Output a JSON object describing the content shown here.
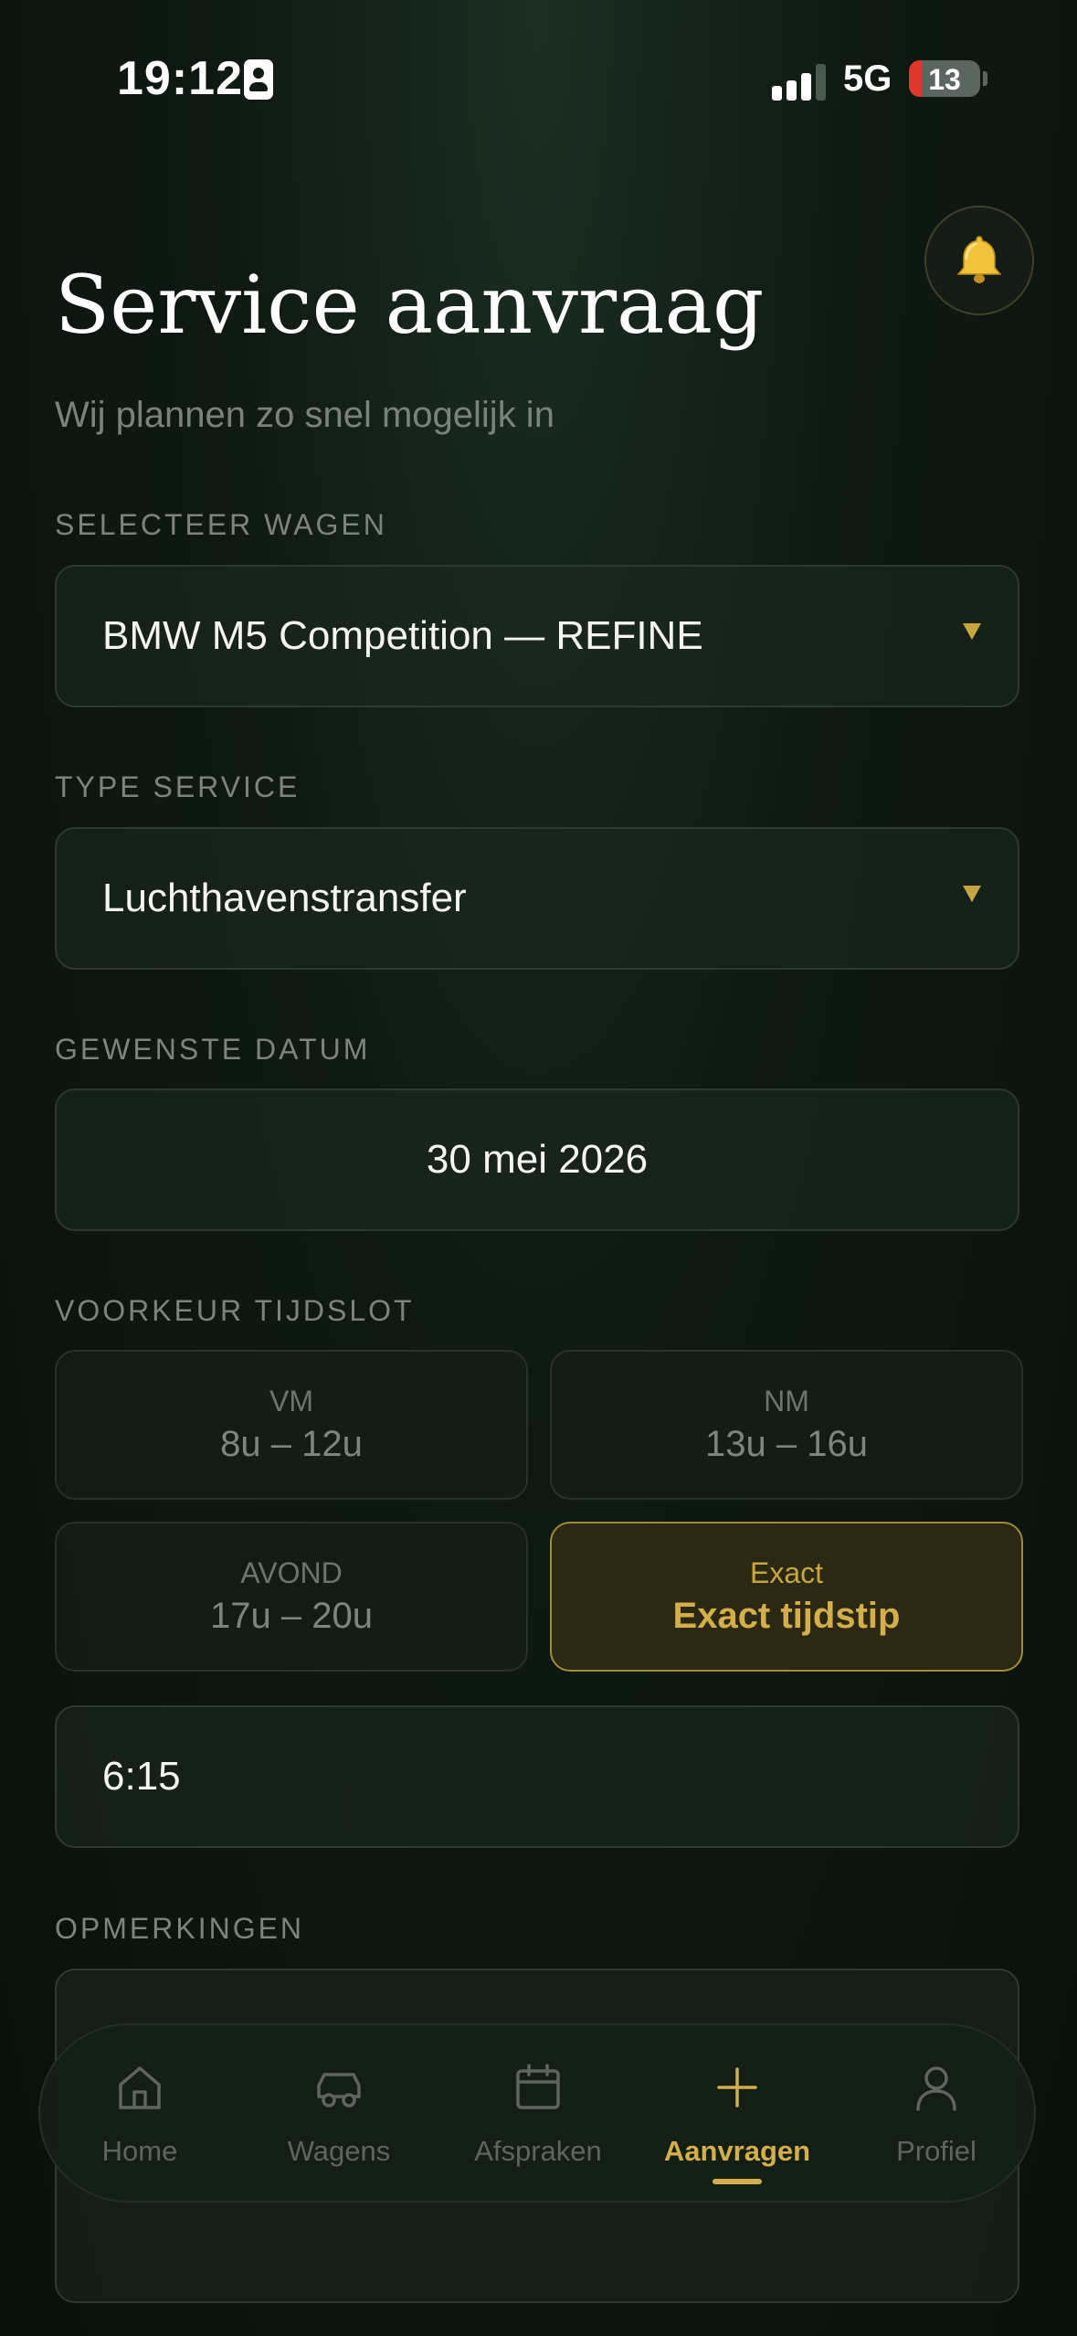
{
  "status_bar": {
    "time": "19:12",
    "network": "5G",
    "battery": "13"
  },
  "header": {
    "title": "Service aanvraag",
    "subtitle": "Wij plannen zo snel mogelijk in"
  },
  "form": {
    "vehicle": {
      "label": "SELECTEER WAGEN",
      "value": "BMW M5 Competition — REFINE"
    },
    "service": {
      "label": "TYPE SERVICE",
      "value": "Luchthavenstransfer"
    },
    "date": {
      "label": "GEWENSTE DATUM",
      "value": "30 mei 2026"
    },
    "timeslot": {
      "label": "VOORKEUR TIJDSLOT",
      "options": [
        {
          "key": "VM",
          "value": "8u – 12u"
        },
        {
          "key": "NM",
          "value": "13u – 16u"
        },
        {
          "key": "AVOND",
          "value": "17u – 20u"
        },
        {
          "key": "Exact",
          "value": "Exact tijdstip"
        }
      ],
      "selected": "Exact"
    },
    "exact_time": {
      "value": "6:15"
    },
    "remarks": {
      "label": "OPMERKINGEN",
      "value": ""
    }
  },
  "nav": {
    "items": [
      {
        "label": "Home"
      },
      {
        "label": "Wagens"
      },
      {
        "label": "Afspraken"
      },
      {
        "label": "Aanvragen"
      },
      {
        "label": "Profiel"
      }
    ],
    "active": "Aanvragen"
  },
  "colors": {
    "accent": "#d4ae4a",
    "background": "#0f1a13",
    "muted_text": "#7a827c"
  }
}
